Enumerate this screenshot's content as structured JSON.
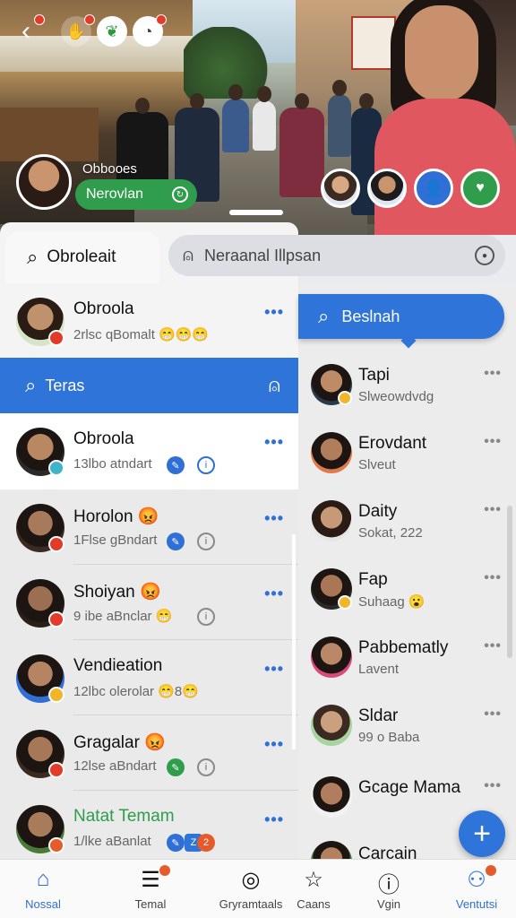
{
  "hero": {
    "story_name": "Obbooes",
    "story_pill_label": "Nerovlan"
  },
  "tabs": [
    {
      "label": "Obroleait",
      "icon": "search-icon"
    },
    {
      "label": "Neraanal  Illpsan",
      "icon": "user-icon"
    }
  ],
  "left_chats": [
    {
      "name": "Obroola",
      "subtitle": "2rlsc qBomalt 😁😁😁",
      "avatar_color": "#c0916d",
      "badge_color": "#e23b2a"
    },
    {
      "name": "Obroola",
      "subtitle": "13lbo atndart",
      "avatar_color": "#b88863",
      "badge_color": "#3fb3c9"
    },
    {
      "name": "Horolon 😡",
      "subtitle": "1Flse gBndart",
      "avatar_color": "#a87a5c",
      "badge_color": "#e23b2a"
    },
    {
      "name": "Shoiyan 😡",
      "subtitle": "9 ibe aBnclar 😁",
      "avatar_color": "#9c6e52",
      "badge_color": "#e23b2a"
    },
    {
      "name": "Vendieation",
      "subtitle": "12lbc olerolar 😁8😁",
      "avatar_color": "#b48463",
      "badge_color": "#f1b52c"
    },
    {
      "name": "Gragalar 😡",
      "subtitle": "12lse aBndart",
      "avatar_color": "#a67858",
      "badge_color": "#e23b2a"
    },
    {
      "name": "Natat Temam",
      "subtitle": "1/lke aBanlat",
      "avatar_color": "#a87b5b",
      "badge_color": "#e55b2b"
    }
  ],
  "teras": {
    "label": "Teras"
  },
  "search": {
    "label": "Beslnah"
  },
  "right_contacts": [
    {
      "name": "Tapi",
      "subtitle": "Slweowdvdg",
      "avatar_color": "#bd8b66"
    },
    {
      "name": "Erovdant",
      "subtitle": "Slveut",
      "avatar_color": "#b17e5c"
    },
    {
      "name": "Daity",
      "subtitle": "Sokat, 222",
      "avatar_color": "#c69a78"
    },
    {
      "name": "Fap",
      "subtitle": "Suhaag 😮",
      "avatar_color": "#a97756"
    },
    {
      "name": "Pabbematly",
      "subtitle": "Lavent",
      "avatar_color": "#b88868"
    },
    {
      "name": "Sldar",
      "subtitle": "99 o Baba",
      "avatar_color": "#caa07f"
    },
    {
      "name": "Gcage Mama",
      "subtitle": "",
      "avatar_color": "#b07e5e"
    },
    {
      "name": "Carcain",
      "subtitle": "",
      "avatar_color": "#b38060"
    }
  ],
  "nav": [
    {
      "label": "Nossal",
      "icon": "home-icon",
      "active": true
    },
    {
      "label": "Temal",
      "icon": "list-icon"
    },
    {
      "label": "Gryramtaals",
      "icon": "target-icon"
    },
    {
      "label": "Caans",
      "icon": "star-icon"
    },
    {
      "label": "Vgin",
      "icon": "alert-icon"
    },
    {
      "label": "Ventutsi",
      "icon": "group-icon"
    }
  ],
  "colors": {
    "accent": "#2f74d8",
    "green": "#2f9d4c",
    "badge_red": "#e23b2a"
  }
}
